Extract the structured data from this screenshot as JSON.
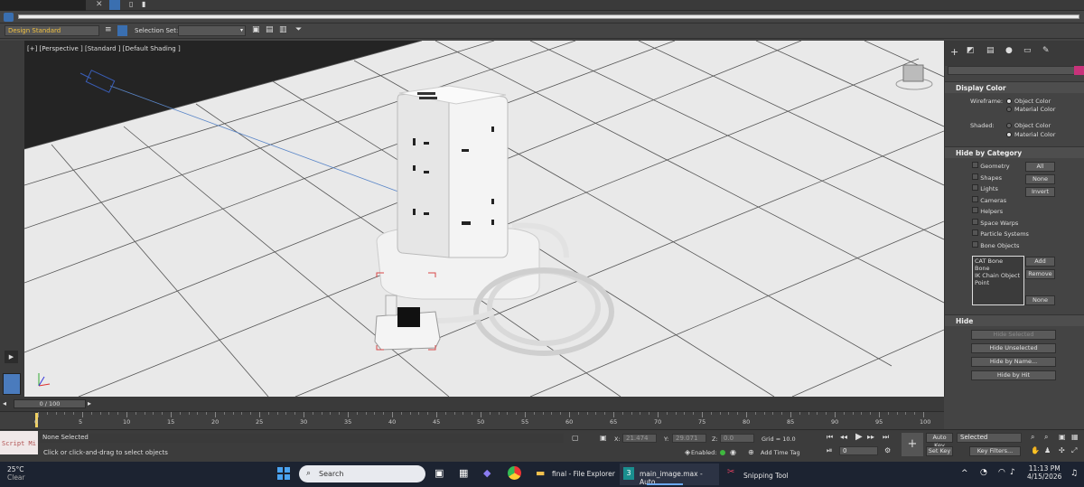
{
  "toolbar": {
    "workspace_value": "Design Standard",
    "selection_set_label": "Selection Set:",
    "selection_set_value": ""
  },
  "viewport": {
    "label": "[+] [Perspective ] [Standard ] [Default Shading ]"
  },
  "command_panel": {
    "display_color": {
      "title": "Display Color",
      "wireframe_label": "Wireframe:",
      "shaded_label": "Shaded:",
      "object_color": "Object Color",
      "material_color": "Material Color"
    },
    "hide_by_category": {
      "title": "Hide by Category",
      "items": [
        "Geometry",
        "Shapes",
        "Lights",
        "Cameras",
        "Helpers",
        "Space Warps",
        "Particle Systems",
        "Bone Objects"
      ],
      "all_btn": "All",
      "none_btn": "None",
      "invert_btn": "Invert",
      "list": [
        "CAT Bone",
        "Bone",
        "IK Chain Object",
        "Point"
      ],
      "add_btn": "Add",
      "remove_btn": "Remove",
      "none_btn2": "None"
    },
    "hide": {
      "title": "Hide",
      "hide_selected": "Hide Selected",
      "hide_unselected": "Hide Unselected",
      "hide_by_name": "Hide by Name...",
      "hide_by_hit": "Hide by Hit"
    }
  },
  "timeline": {
    "frame_counter": "0 / 100",
    "ticks": [
      "0",
      "5",
      "10",
      "15",
      "20",
      "25",
      "30",
      "35",
      "40",
      "45",
      "50",
      "55",
      "60",
      "65",
      "70",
      "75",
      "80",
      "85",
      "90",
      "95",
      "100"
    ]
  },
  "status": {
    "script_label": "Script Mi",
    "selection_status": "None Selected",
    "prompt": "Click or click-and-drag to select objects",
    "x_label": "X:",
    "x_value": "21.474",
    "y_label": "Y:",
    "y_value": "29.071",
    "z_label": "Z:",
    "z_value": "0.0",
    "grid": "Grid = 10.0",
    "enabled": "Enabled:",
    "add_time_tag": "Add Time Tag",
    "auto_key": "Auto Key",
    "set_key": "Set Key",
    "key_mode_value": "Selected",
    "key_filters": "Key Filters...",
    "current_frame": "0"
  },
  "taskbar": {
    "weather_temp": "25°C",
    "weather_desc": "Clear",
    "search_placeholder": "Search",
    "file_explorer": "final - File Explorer",
    "max_app": "main_image.max - Auto",
    "snipping": "Snipping Tool",
    "time": "11:13 PM",
    "date": "4/15/2026"
  },
  "colors": {
    "accent": "#3a8ee6",
    "pink": "#c8327a",
    "grid_floor": "#e8e8e8"
  }
}
